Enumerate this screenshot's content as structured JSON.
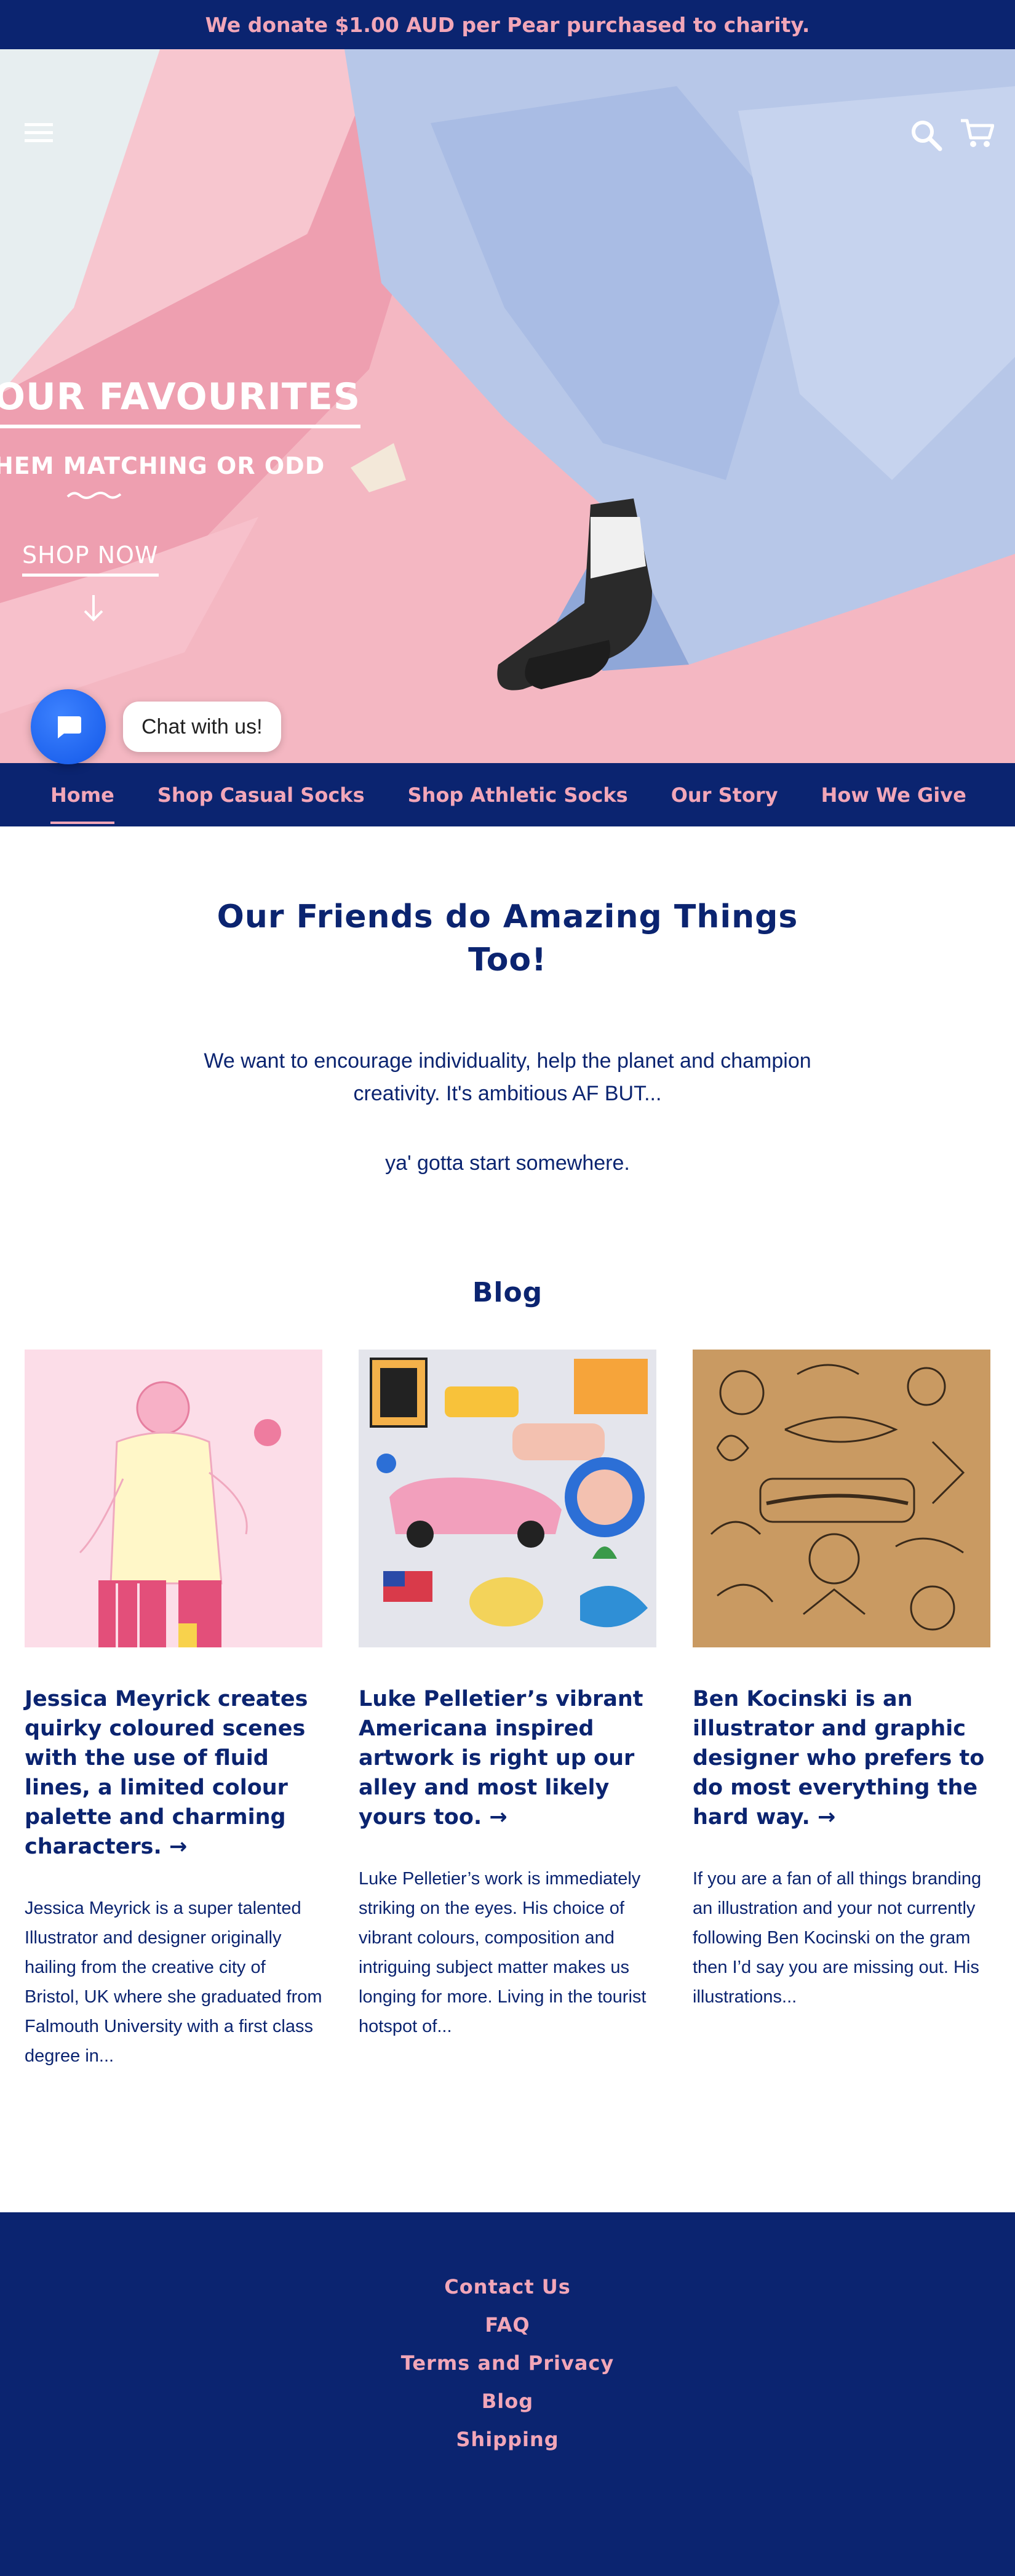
{
  "announcement": "We donate $1.00 AUD per Pear purchased to charity.",
  "colors": {
    "navy": "#0b2470",
    "pink": "#f2a6b8",
    "chat_blue": "#1e6bff"
  },
  "header_icons": [
    "hamburger-menu-icon",
    "search-icon",
    "cart-icon"
  ],
  "hero": {
    "title": "OUR FAVOURITES",
    "subtitle": "HEM MATCHING OR ODD",
    "cta": "SHOP NOW"
  },
  "chat": {
    "label": "Chat with us!"
  },
  "nav": {
    "items": [
      {
        "label": "Home",
        "active": true
      },
      {
        "label": "Shop Casual Socks"
      },
      {
        "label": "Shop Athletic Socks"
      },
      {
        "label": "Our Story"
      },
      {
        "label": "How We Give"
      }
    ]
  },
  "intro": {
    "title": "Our Friends do Amazing Things Too!",
    "paragraph": "We want to encourage individuality, help the planet and champion creativity. It's ambitious AF BUT...",
    "tagline": "ya' gotta start somewhere."
  },
  "blog": {
    "heading": "Blog",
    "posts": [
      {
        "title": "Jessica Meyrick creates quirky coloured scenes with the use of fluid lines, a limited colour palette and charming characters. →",
        "excerpt": "Jessica Meyrick is a super talented Illustrator and designer originally hailing from the creative city of Bristol, UK where she graduated from Falmouth University with a first class degree in..."
      },
      {
        "title": "Luke Pelletier’s vibrant Americana inspired artwork is right up our alley and most likely yours too. →",
        "excerpt": "Luke Pelletier’s work is immediately striking on the eyes. His choice of vibrant colours, composition and intriguing subject matter makes us longing for more. Living in the tourist hotspot of..."
      },
      {
        "title": "Ben Kocinski is an illustrator and graphic designer who prefers to do most everything the hard way. →",
        "excerpt": "If you are a fan of all things branding an illustration and your not currently following Ben Kocinski on the gram then I’d say you are missing out. His illustrations..."
      }
    ]
  },
  "footer": {
    "links": [
      "Contact Us",
      "FAQ",
      "Terms and Privacy",
      "Blog",
      "Shipping"
    ]
  }
}
